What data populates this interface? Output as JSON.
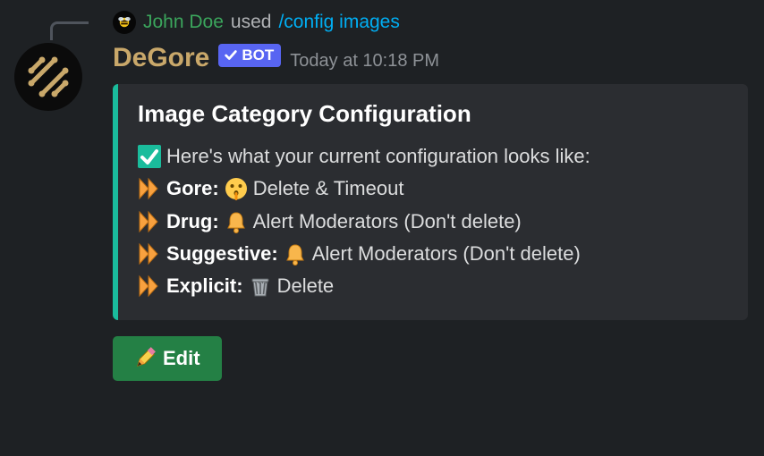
{
  "reply": {
    "user": "John Doe",
    "verb": "used",
    "command": "/config images"
  },
  "message": {
    "author": "DeGore",
    "bot_tag": "BOT",
    "timestamp": "Today at 10:18 PM"
  },
  "embed": {
    "accent_color": "#1abc9c",
    "title": "Image Category Configuration",
    "intro": "Here's what your current configuration looks like:",
    "rows": [
      {
        "label": "Gore:",
        "icon": "shush-face",
        "value": "Delete & Timeout"
      },
      {
        "label": "Drug:",
        "icon": "bell",
        "value": "Alert Moderators (Don't delete)"
      },
      {
        "label": "Suggestive:",
        "icon": "bell",
        "value": "Alert Moderators (Don't delete)"
      },
      {
        "label": "Explicit:",
        "icon": "wastebasket",
        "value": "Delete"
      }
    ]
  },
  "button": {
    "label": "Edit"
  }
}
